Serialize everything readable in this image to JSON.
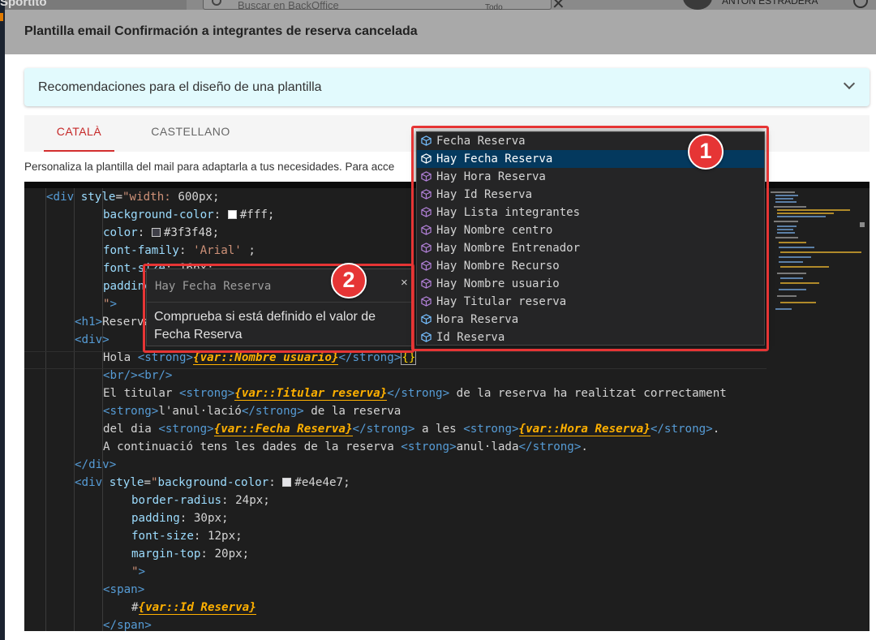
{
  "background": {
    "search_placeholder": "Buscar en BackOffice",
    "filter_label": "Todo",
    "user_name": "ANTON ESTRADERA",
    "brand": "Sportito"
  },
  "modal": {
    "title": "Plantilla email Confirmación a integrantes de reserva cancelada",
    "accordion_label": "Recomendaciones para el diseño de una plantilla",
    "tabs": [
      {
        "label": "CATALÀ",
        "active": true
      },
      {
        "label": "CASTELLANO",
        "active": false
      }
    ],
    "help_text": "Personaliza la plantilla del mail para adaptarla a tus necesidades. Para acce"
  },
  "editor": {
    "lines": [
      "<div style=\"width: 600px;",
      "background-color: #fff;",
      "color: #3f3f48;",
      "font-family: 'Arial' ;",
      "font-size: 16px;",
      "padding",
      "\">",
      "<h1>Reserva",
      "<div>",
      "Hola <strong>{var::Nombre usuario}</strong>{}",
      "<br/><br/>",
      "El titular <strong>{var::Titular reserva}</strong> de la reserva ha realitzat correctament",
      "<strong>l'anul·lació</strong> de la reserva",
      "del dia <strong>{var::Fecha Reserva}</strong> a les <strong>{var::Hora Reserva}</strong>.",
      "A continuació tens les dades de la reserva <strong>anul·lada</strong>.",
      "</div>",
      "<div style=\"background-color: #e4e4e7;",
      "border-radius: 24px;",
      "padding: 30px;",
      "font-size: 12px;",
      "margin-top: 20px;",
      "\">",
      "<span>",
      "#{var::Id Reserva}",
      "</span>"
    ],
    "colors": {
      "swatch_white": "#ffffff",
      "swatch_dark": "#3f3f48",
      "swatch_grey": "#e4e4e7"
    }
  },
  "suggestions": {
    "items": [
      {
        "label": "Fecha Reserva",
        "icon": "variable-icon",
        "selected": false
      },
      {
        "label": "Hay Fecha Reserva",
        "icon": "cube-icon",
        "selected": true
      },
      {
        "label": "Hay Hora Reserva",
        "icon": "cube-icon",
        "selected": false
      },
      {
        "label": "Hay Id Reserva",
        "icon": "cube-icon",
        "selected": false
      },
      {
        "label": "Hay Lista integrantes",
        "icon": "cube-icon",
        "selected": false
      },
      {
        "label": "Hay Nombre centro",
        "icon": "cube-icon",
        "selected": false
      },
      {
        "label": "Hay Nombre Entrenador",
        "icon": "cube-icon",
        "selected": false
      },
      {
        "label": "Hay Nombre Recurso",
        "icon": "cube-icon",
        "selected": false
      },
      {
        "label": "Hay Nombre usuario",
        "icon": "cube-icon",
        "selected": false
      },
      {
        "label": "Hay Titular reserva",
        "icon": "cube-icon",
        "selected": false
      },
      {
        "label": "Hora Reserva",
        "icon": "variable-icon",
        "selected": false
      },
      {
        "label": "Id Reserva",
        "icon": "variable-icon",
        "selected": false
      }
    ],
    "callout_number": "1"
  },
  "hover": {
    "title": "Hay Fecha Reserva",
    "close": "×",
    "description": "Comprueba si está definido el valor de Fecha Reserva",
    "callout_number": "2"
  },
  "theme": {
    "accent_red": "#d32f2f",
    "callout_red": "#e63535",
    "editor_bg": "#1e1e1e",
    "selection_blue": "#04395e",
    "accordion_bg": "#e2fafd"
  }
}
